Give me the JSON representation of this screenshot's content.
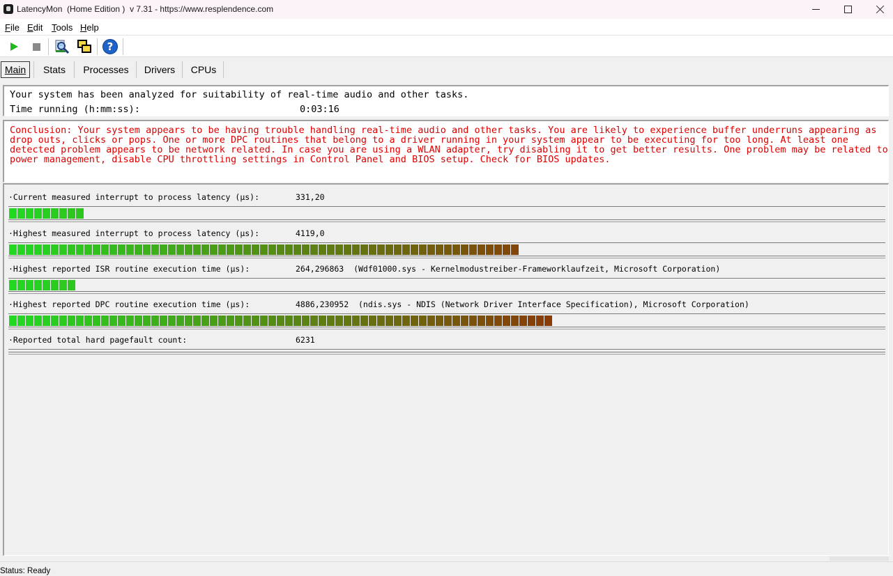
{
  "window": {
    "title": "LatencyMon  (Home Edition )  v 7.31 - https://www.resplendence.com"
  },
  "menu": {
    "file": "File",
    "edit": "Edit",
    "tools": "Tools",
    "help": "Help"
  },
  "toolbar": {
    "icons": [
      "play-icon",
      "stop-icon",
      "analyze-icon",
      "window-icon",
      "help-icon"
    ],
    "help_glyph": "?"
  },
  "tabs": {
    "main": "Main",
    "stats": "Stats",
    "processes": "Processes",
    "drivers": "Drivers",
    "cpus": "CPUs"
  },
  "info": {
    "analyzed": "Your system has been analyzed for suitability of real-time audio and other tasks.",
    "time_label": "Time running (h:mm:ss):",
    "time_value": "0:03:16"
  },
  "conclusion": {
    "text": "Conclusion: Your system appears to be having trouble handling real-time audio and other tasks. You are likely to experience buffer underruns appearing as\ndrop outs, clicks or pops. One or more DPC routines that belong to a driver running in your system appear to be executing for too long. At least one\ndetected problem appears to be network related. In case you are using a WLAN adapter, try disabling it to get better results. One problem may be related to\npower management, disable CPU throttling settings in Control Panel and BIOS setup. Check for BIOS updates.",
    "color": "#e00000"
  },
  "metrics": [
    {
      "label": "·Current measured interrupt to process latency (µs):",
      "value": "331,20",
      "segments": 9
    },
    {
      "label": "·Highest measured interrupt to process latency (µs):",
      "value": "4119,0",
      "segments": 61
    },
    {
      "label": "·Highest reported ISR routine execution time (µs):",
      "value": "264,296863  (Wdf01000.sys - Kernelmodustreiber-Frameworklaufzeit, Microsoft Corporation)",
      "segments": 8
    },
    {
      "label": "·Highest reported DPC routine execution time (µs):",
      "value": "4886,230952  (ndis.sys - NDIS (Network Driver Interface Specification), Microsoft Corporation)",
      "segments": 65
    },
    {
      "label": "·Reported total hard pagefault count:",
      "value": "6231",
      "segments": 0
    }
  ],
  "colors": {
    "bar_green": "#22d822",
    "bar_red": "#a31500"
  },
  "status": {
    "text": "Status: Ready"
  }
}
